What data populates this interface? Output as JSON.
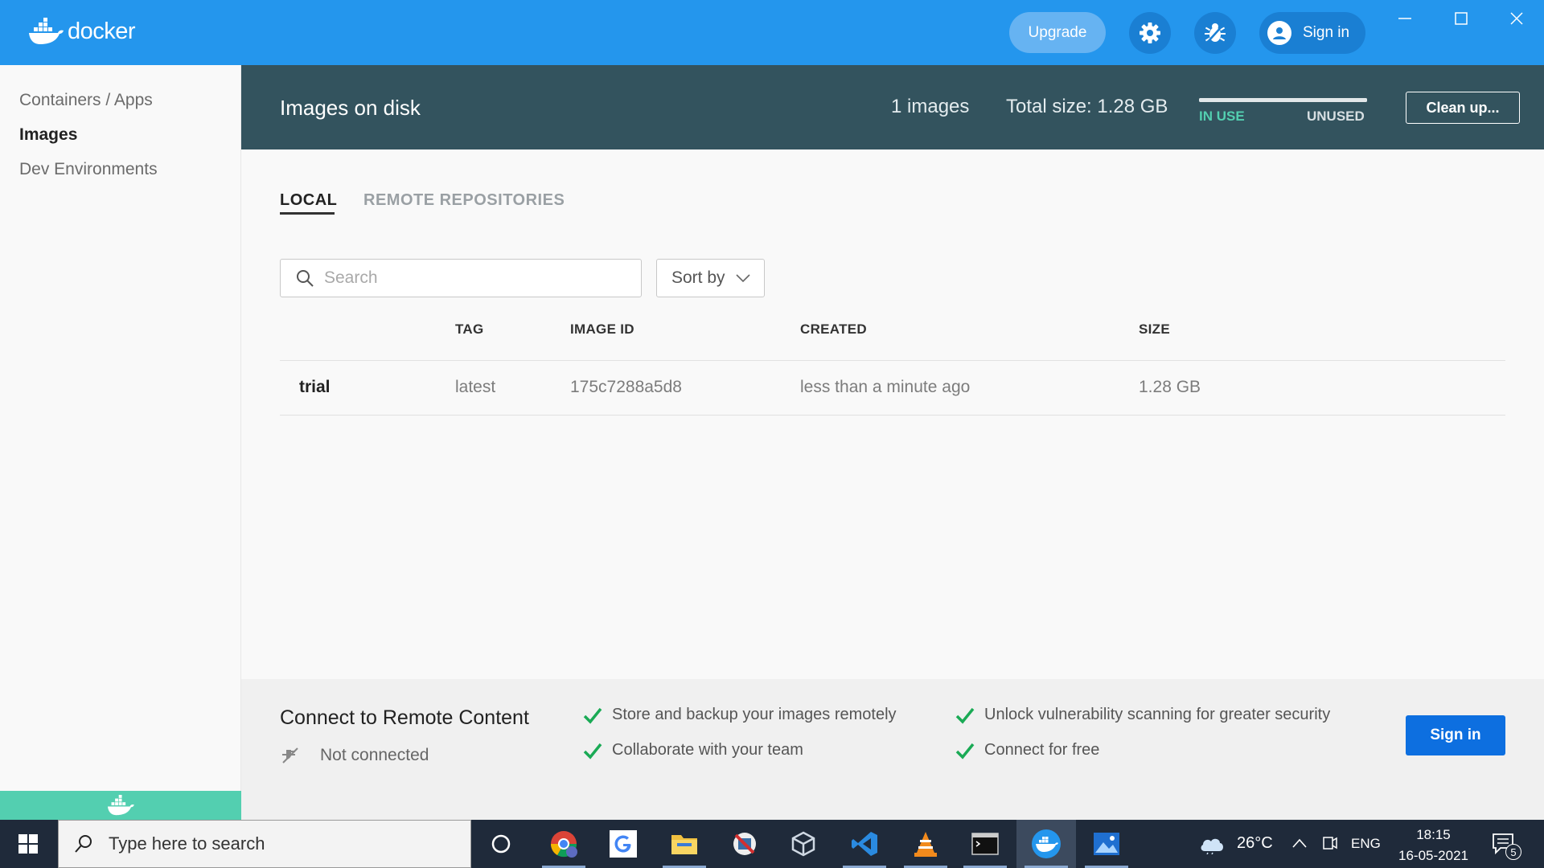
{
  "app": {
    "brand": "docker"
  },
  "topbar": {
    "upgrade_label": "Upgrade",
    "signin_label": "Sign in",
    "colors": {
      "bar": "#2496ed",
      "button": "#1a7fd3"
    }
  },
  "sidebar": {
    "items": [
      {
        "label": "Containers / Apps"
      },
      {
        "label": "Images"
      },
      {
        "label": "Dev Environments"
      }
    ]
  },
  "header": {
    "title": "Images on disk",
    "image_count": "1 images",
    "total_size": "Total size: 1.28 GB",
    "in_use_label": "IN USE",
    "unused_label": "UNUSED",
    "in_use_fraction": 1.0,
    "cleanup_label": "Clean up..."
  },
  "tabs": [
    {
      "label": "LOCAL"
    },
    {
      "label": "REMOTE REPOSITORIES"
    }
  ],
  "search": {
    "placeholder": "Search",
    "value": ""
  },
  "sort": {
    "label": "Sort by"
  },
  "table": {
    "columns": [
      "TAG",
      "IMAGE ID",
      "CREATED",
      "SIZE"
    ],
    "rows": [
      {
        "name": "trial",
        "tag": "latest",
        "image_id": "175c7288a5d8",
        "created": "less than a minute ago",
        "size": "1.28 GB"
      }
    ]
  },
  "remote_panel": {
    "title": "Connect to Remote Content",
    "status": "Not connected",
    "features": [
      "Store and backup your images remotely",
      "Collaborate with your team",
      "Unlock vulnerability scanning for greater security",
      "Connect for free"
    ],
    "signin_label": "Sign in"
  },
  "taskbar": {
    "search_placeholder": "Type here to search",
    "weather": "26°C",
    "language": "ENG",
    "time": "18:15",
    "date": "16-05-2021",
    "notifications": "5"
  }
}
